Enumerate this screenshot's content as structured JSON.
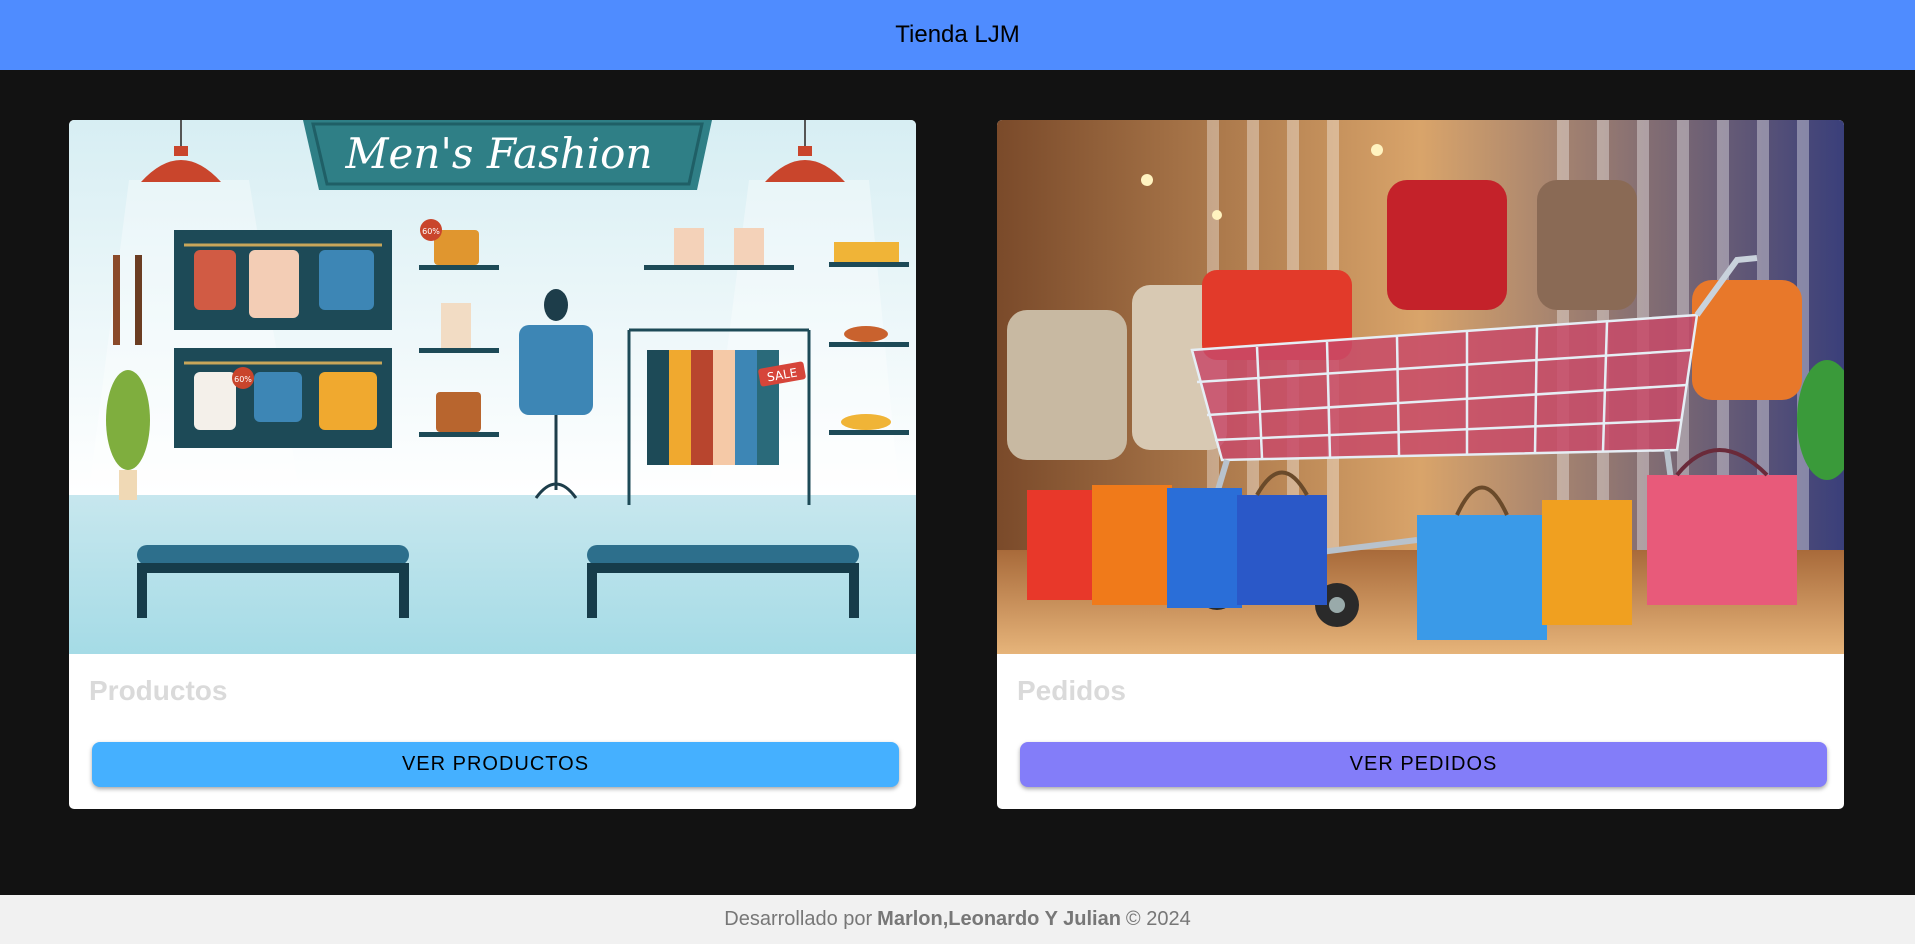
{
  "header": {
    "title": "Tienda LJM"
  },
  "cards": [
    {
      "image": {
        "banner_text": "Men's Fashion",
        "badge_1": "60%",
        "badge_2": "60%",
        "tag": "SALE"
      },
      "title": "Productos",
      "button_label": "VER PRODUCTOS",
      "button_color": "#45b0ff"
    },
    {
      "title": "Pedidos",
      "button_label": "VER PEDIDOS",
      "button_color": "#837df9"
    }
  ],
  "footer": {
    "prefix": "Desarrollado por",
    "authors": "Marlon,Leonardo Y Julian",
    "suffix": "© 2024"
  },
  "colors": {
    "header_bg": "#4f8cff",
    "page_bg": "#121212",
    "footer_bg": "#f1f1f1"
  }
}
